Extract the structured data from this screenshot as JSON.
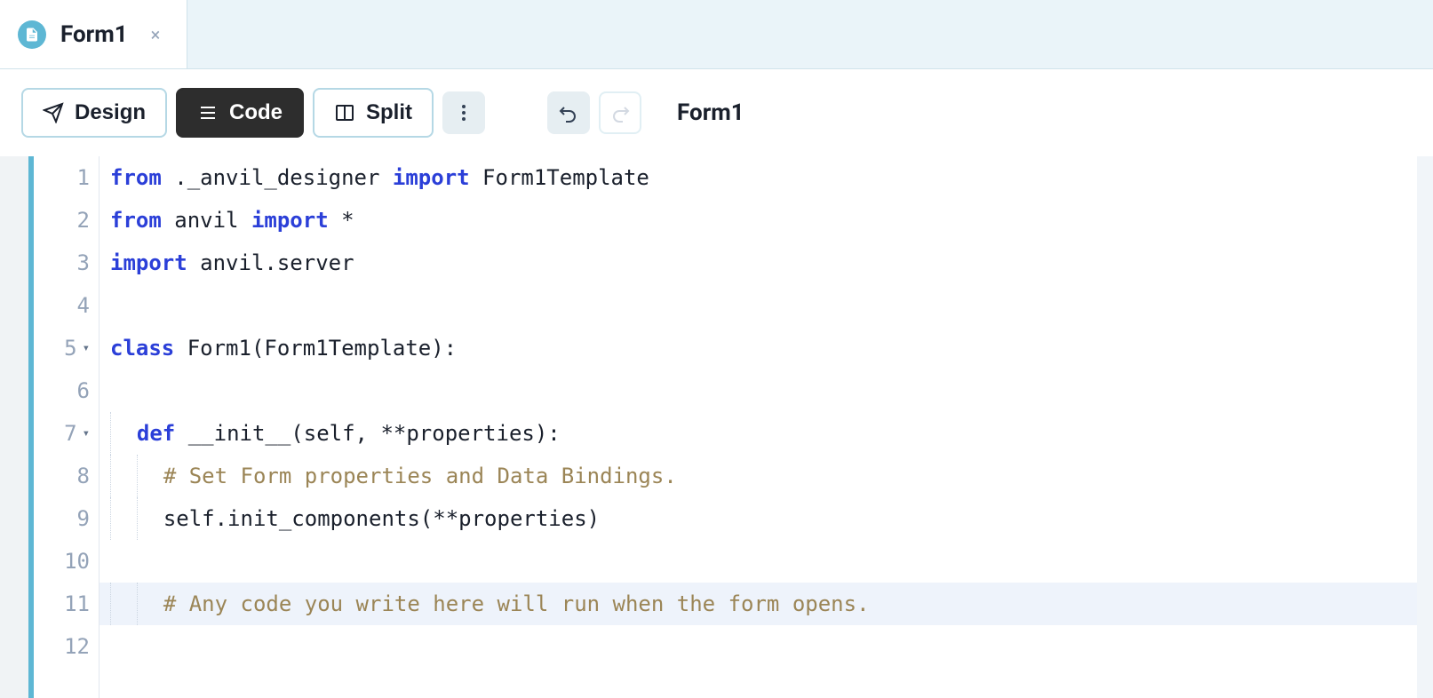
{
  "tab": {
    "title": "Form1",
    "close_label": "×"
  },
  "toolbar": {
    "design_label": "Design",
    "code_label": "Code",
    "split_label": "Split",
    "breadcrumb": "Form1"
  },
  "editor": {
    "lines": [
      {
        "num": "1",
        "fold": "",
        "indent": 0,
        "highlighted": false,
        "tokens": [
          [
            "kw",
            "from"
          ],
          [
            "txt",
            " ._anvil_designer "
          ],
          [
            "kw",
            "import"
          ],
          [
            "txt",
            " Form1Template"
          ]
        ]
      },
      {
        "num": "2",
        "fold": "",
        "indent": 0,
        "highlighted": false,
        "tokens": [
          [
            "kw",
            "from"
          ],
          [
            "txt",
            " anvil "
          ],
          [
            "kw",
            "import"
          ],
          [
            "txt",
            " *"
          ]
        ]
      },
      {
        "num": "3",
        "fold": "",
        "indent": 0,
        "highlighted": false,
        "tokens": [
          [
            "kw",
            "import"
          ],
          [
            "txt",
            " anvil.server"
          ]
        ]
      },
      {
        "num": "4",
        "fold": "",
        "indent": 0,
        "highlighted": false,
        "tokens": []
      },
      {
        "num": "5",
        "fold": "▾",
        "indent": 0,
        "highlighted": false,
        "tokens": [
          [
            "kw",
            "class"
          ],
          [
            "txt",
            " Form1(Form1Template):"
          ]
        ]
      },
      {
        "num": "6",
        "fold": "",
        "indent": 0,
        "highlighted": false,
        "tokens": []
      },
      {
        "num": "7",
        "fold": "▾",
        "indent": 1,
        "highlighted": false,
        "tokens": [
          [
            "kw",
            "def"
          ],
          [
            "txt",
            " __init__(self, **properties):"
          ]
        ]
      },
      {
        "num": "8",
        "fold": "",
        "indent": 2,
        "highlighted": false,
        "tokens": [
          [
            "cmt",
            "# Set Form properties and Data Bindings."
          ]
        ]
      },
      {
        "num": "9",
        "fold": "",
        "indent": 2,
        "highlighted": false,
        "tokens": [
          [
            "txt",
            "self.init_components(**properties)"
          ]
        ]
      },
      {
        "num": "10",
        "fold": "",
        "indent": 0,
        "highlighted": false,
        "tokens": []
      },
      {
        "num": "11",
        "fold": "",
        "indent": 2,
        "highlighted": true,
        "tokens": [
          [
            "cmt",
            "# Any code you write here will run when the form opens."
          ]
        ]
      },
      {
        "num": "12",
        "fold": "",
        "indent": 0,
        "highlighted": false,
        "tokens": []
      }
    ]
  }
}
